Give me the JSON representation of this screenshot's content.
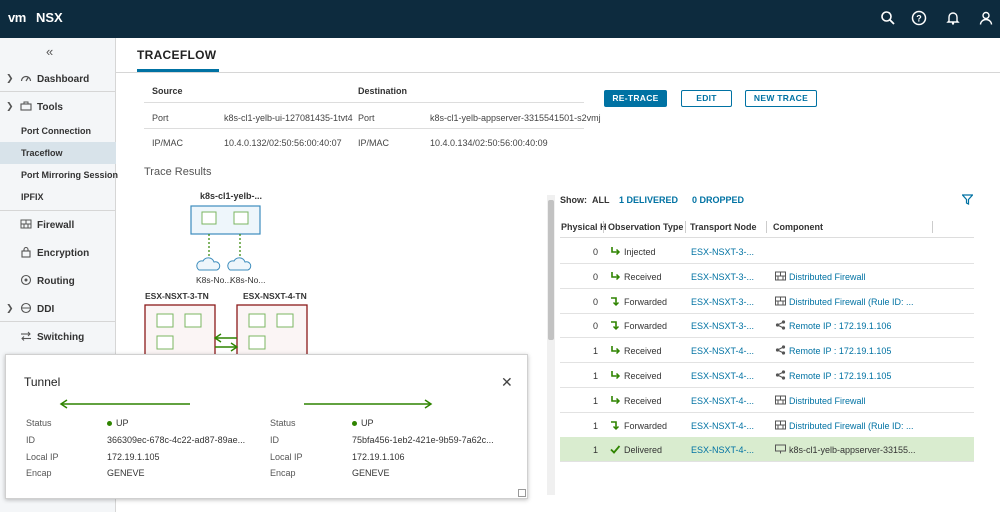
{
  "header": {
    "logo": "vm",
    "app_name": "NSX",
    "icons": [
      "search-icon",
      "help-icon",
      "bell-icon",
      "user-icon"
    ]
  },
  "sidebar": {
    "collapse": "«",
    "items": [
      {
        "label": "Dashboard",
        "icon": "dashboard-icon"
      },
      {
        "label": "Tools",
        "icon": "tools-icon"
      },
      {
        "label": "Firewall",
        "icon": "firewall-icon"
      },
      {
        "label": "Encryption",
        "icon": "encryption-icon"
      },
      {
        "label": "Routing",
        "icon": "routing-icon"
      },
      {
        "label": "DDI",
        "icon": "ddi-icon"
      },
      {
        "label": "Switching",
        "icon": "switching-icon"
      }
    ],
    "tools_sub": [
      "Port Connection",
      "Traceflow",
      "Port Mirroring Session",
      "IPFIX"
    ],
    "active_sub": "Traceflow"
  },
  "page": {
    "title": "TRACEFLOW",
    "source_header": "Source",
    "destination_header": "Destination",
    "rows": [
      {
        "label": "Port",
        "src": "k8s-cl1-yelb-ui-127081435-1tvt4",
        "dlabel": "Port",
        "dst": "k8s-cl1-yelb-appserver-3315541501-s2vmj"
      },
      {
        "label": "IP/MAC",
        "src": "10.4.0.132/02:50:56:00:40:07",
        "dlabel": "IP/MAC",
        "dst": "10.4.0.134/02:50:56:00:40:09"
      }
    ],
    "buttons": {
      "retrace": "RE-TRACE",
      "edit": "EDIT",
      "new_trace": "NEW TRACE"
    },
    "trace_results": "Trace Results"
  },
  "topology": {
    "pod_label": "k8s-cl1-yelb-...",
    "node1_label": "K8s-No...",
    "node2_label": "K8s-No...",
    "tn1": "ESX-NSXT-3-TN",
    "tn2": "ESX-NSXT-4-TN"
  },
  "results": {
    "show_label": "Show:",
    "filter_all": "ALL",
    "filter_delivered": "1 DELIVERED",
    "filter_dropped": "0 DROPPED",
    "columns": [
      "Physical H",
      "Observation Type",
      "Transport Node",
      "Component"
    ],
    "rows": [
      {
        "phys": "0",
        "obs": "Injected",
        "obs_icon": "injected-arrow-icon",
        "node": "ESX-NSXT-3-...",
        "comp": "",
        "comp_icon": ""
      },
      {
        "phys": "0",
        "obs": "Received",
        "obs_icon": "received-arrow-icon",
        "node": "ESX-NSXT-3-...",
        "comp": "Distributed Firewall",
        "comp_icon": "firewall-icon"
      },
      {
        "phys": "0",
        "obs": "Forwarded",
        "obs_icon": "forwarded-arrow-icon",
        "node": "ESX-NSXT-3-...",
        "comp": "Distributed Firewall (Rule ID: ...",
        "comp_icon": "firewall-icon"
      },
      {
        "phys": "0",
        "obs": "Forwarded",
        "obs_icon": "forwarded-arrow-icon",
        "node": "ESX-NSXT-3-...",
        "comp": "Remote IP : 172.19.1.106",
        "comp_icon": "share-icon"
      },
      {
        "phys": "1",
        "obs": "Received",
        "obs_icon": "received-arrow-icon",
        "node": "ESX-NSXT-4-...",
        "comp": "Remote IP : 172.19.1.105",
        "comp_icon": "share-icon"
      },
      {
        "phys": "1",
        "obs": "Received",
        "obs_icon": "received-arrow-icon",
        "node": "ESX-NSXT-4-...",
        "comp": "Remote IP : 172.19.1.105",
        "comp_icon": "share-icon"
      },
      {
        "phys": "1",
        "obs": "Received",
        "obs_icon": "received-arrow-icon",
        "node": "ESX-NSXT-4-...",
        "comp": "Distributed Firewall",
        "comp_icon": "firewall-icon"
      },
      {
        "phys": "1",
        "obs": "Forwarded",
        "obs_icon": "forwarded-arrow-icon",
        "node": "ESX-NSXT-4-...",
        "comp": "Distributed Firewall (Rule ID: ...",
        "comp_icon": "firewall-icon"
      },
      {
        "phys": "1",
        "obs": "Delivered",
        "obs_icon": "delivered-check-icon",
        "node": "ESX-NSXT-4-...",
        "comp": "k8s-cl1-yelb-appserver-33155...",
        "comp_icon": "vnic-icon"
      }
    ]
  },
  "tunnel": {
    "title": "Tunnel",
    "left": {
      "status_key": "Status",
      "status": "UP",
      "id_key": "ID",
      "id": "366309ec-678c-4c22-ad87-89ae...",
      "localip_key": "Local IP",
      "localip": "172.19.1.105",
      "encap_key": "Encap",
      "encap": "GENEVE"
    },
    "right": {
      "status_key": "Status",
      "status": "UP",
      "id_key": "ID",
      "id": "75bfa456-1eb2-421e-9b59-7a62c...",
      "localip_key": "Local IP",
      "localip": "172.19.1.106",
      "encap_key": "Encap",
      "encap": "GENEVE"
    }
  },
  "colors": {
    "header_bg": "#0d2b3e",
    "accent": "#0072a3",
    "success": "#2f8400",
    "delivered_bg": "#d9eccf",
    "tn_border": "#8b1a1a",
    "pod_border": "#3d8dbd"
  }
}
